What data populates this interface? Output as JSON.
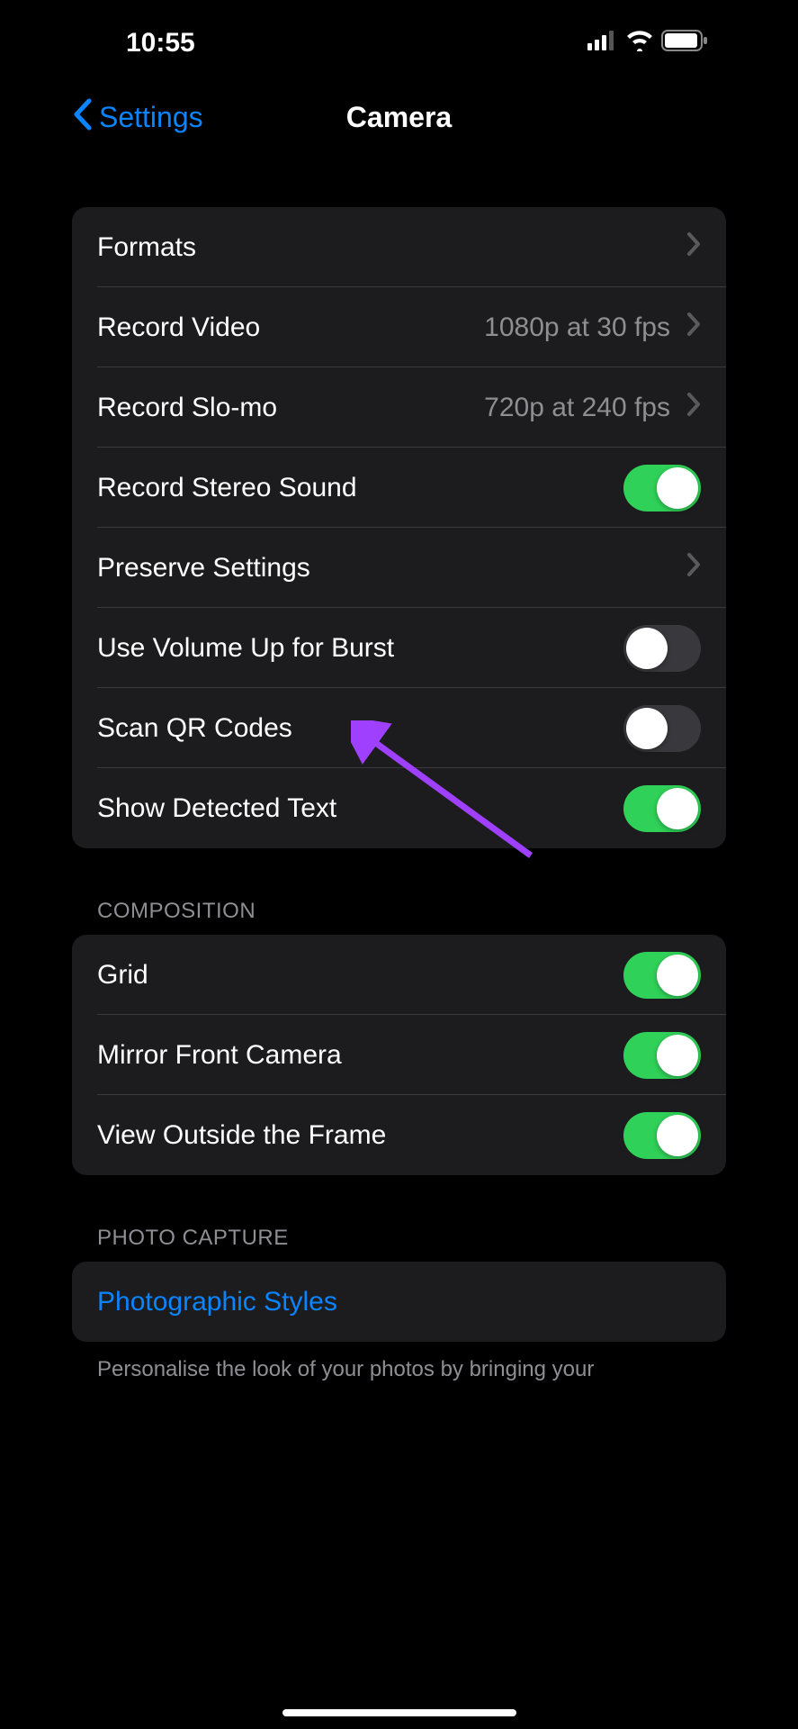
{
  "status_bar": {
    "time": "10:55"
  },
  "nav": {
    "back_label": "Settings",
    "title": "Camera"
  },
  "sections": {
    "main": {
      "formats": {
        "label": "Formats"
      },
      "record_video": {
        "label": "Record Video",
        "value": "1080p at 30 fps"
      },
      "record_slomo": {
        "label": "Record Slo-mo",
        "value": "720p at 240 fps"
      },
      "stereo_sound": {
        "label": "Record Stereo Sound",
        "on": true
      },
      "preserve": {
        "label": "Preserve Settings"
      },
      "volume_burst": {
        "label": "Use Volume Up for Burst",
        "on": false
      },
      "scan_qr": {
        "label": "Scan QR Codes",
        "on": false
      },
      "detected_text": {
        "label": "Show Detected Text",
        "on": true
      }
    },
    "composition": {
      "header": "COMPOSITION",
      "grid": {
        "label": "Grid",
        "on": true
      },
      "mirror": {
        "label": "Mirror Front Camera",
        "on": true
      },
      "outside_frame": {
        "label": "View Outside the Frame",
        "on": true
      }
    },
    "photo_capture": {
      "header": "PHOTO CAPTURE",
      "styles": {
        "label": "Photographic Styles"
      },
      "footer": "Personalise the look of your photos by bringing your"
    }
  }
}
